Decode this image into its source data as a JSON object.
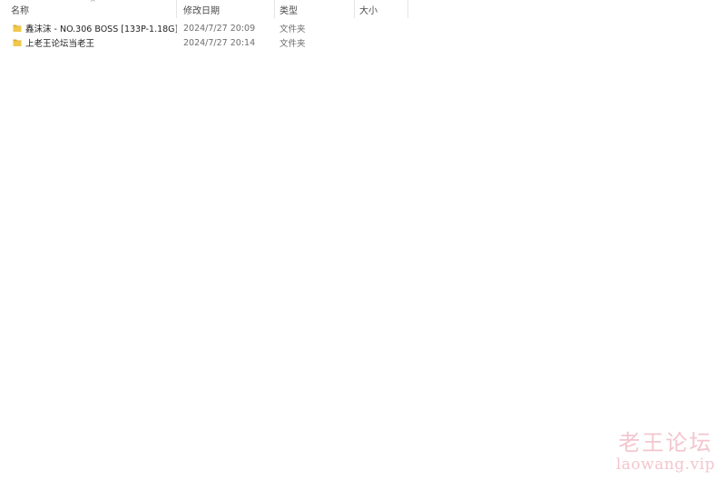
{
  "columns": {
    "name": "名称",
    "date": "修改日期",
    "type": "类型",
    "size": "大小"
  },
  "sort_indicator": "^",
  "files": [
    {
      "icon": "folder-icon",
      "name": "鑫沫沫 - NO.306 BOSS [133P-1.18G]",
      "date": "2024/7/27 20:09",
      "type": "文件夹",
      "size": ""
    },
    {
      "icon": "folder-icon",
      "name": "上老王论坛当老王",
      "date": "2024/7/27 20:14",
      "type": "文件夹",
      "size": ""
    }
  ],
  "watermark": {
    "title": "老王论坛",
    "url": "laowang.vip"
  },
  "colors": {
    "folder": "#f0c94a",
    "folder_dark": "#dba92e",
    "watermark": "#f3c6cf"
  }
}
